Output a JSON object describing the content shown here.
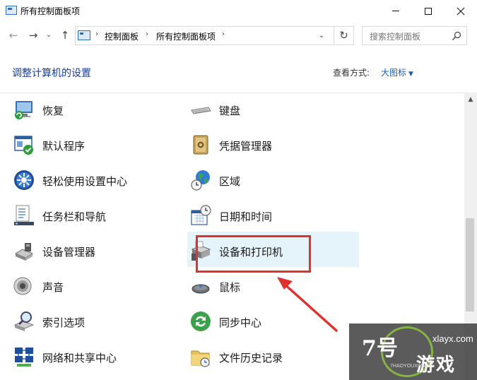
{
  "window": {
    "title": "所有控制面板项",
    "minimize_glyph": "—",
    "maximize_glyph": "□",
    "close_glyph": "✕"
  },
  "nav": {
    "back_glyph": "←",
    "forward_glyph": "→",
    "recent_glyph": "⌄",
    "up_glyph": "↑",
    "breadcrumb_sep": "›",
    "breadcrumb": [
      "控制面板",
      "所有控制面板项"
    ],
    "dropdown_glyph": "⌄",
    "refresh_glyph": "↻",
    "search_placeholder": "搜索控制面板"
  },
  "header": {
    "title": "调整计算机的设置",
    "view_by_label": "查看方式:",
    "view_by_value": "大图标",
    "caret": "▼"
  },
  "items_left": [
    {
      "label": "恢复",
      "icon": "recovery-icon"
    },
    {
      "label": "默认程序",
      "icon": "default-programs-icon"
    },
    {
      "label": "轻松使用设置中心",
      "icon": "ease-of-access-icon"
    },
    {
      "label": "任务栏和导航",
      "icon": "taskbar-icon"
    },
    {
      "label": "设备管理器",
      "icon": "device-manager-icon"
    },
    {
      "label": "声音",
      "icon": "sound-icon"
    },
    {
      "label": "索引选项",
      "icon": "indexing-icon"
    },
    {
      "label": "网络和共享中心",
      "icon": "network-icon"
    }
  ],
  "items_right": [
    {
      "label": "键盘",
      "icon": "keyboard-icon"
    },
    {
      "label": "凭据管理器",
      "icon": "credential-manager-icon"
    },
    {
      "label": "区域",
      "icon": "region-icon"
    },
    {
      "label": "日期和时间",
      "icon": "date-time-icon"
    },
    {
      "label": "设备和打印机",
      "icon": "printer-icon",
      "highlighted": true
    },
    {
      "label": "鼠标",
      "icon": "mouse-icon"
    },
    {
      "label": "同步中心",
      "icon": "sync-center-icon"
    },
    {
      "label": "文件历史记录",
      "icon": "file-history-icon"
    }
  ],
  "scrollbar": {
    "up_glyph": "▲",
    "position_fraction": 0.56
  },
  "annotation": {
    "color": "#e0312d"
  },
  "watermark": {
    "number": "7号",
    "domain": "xlayx.com",
    "brand": "游戏",
    "pinyin": "7HAOYOUXIWANG"
  },
  "colors": {
    "accent": "#1a5fb4",
    "title_blue": "#1e3d8f",
    "highlight": "#e5f3fb"
  }
}
